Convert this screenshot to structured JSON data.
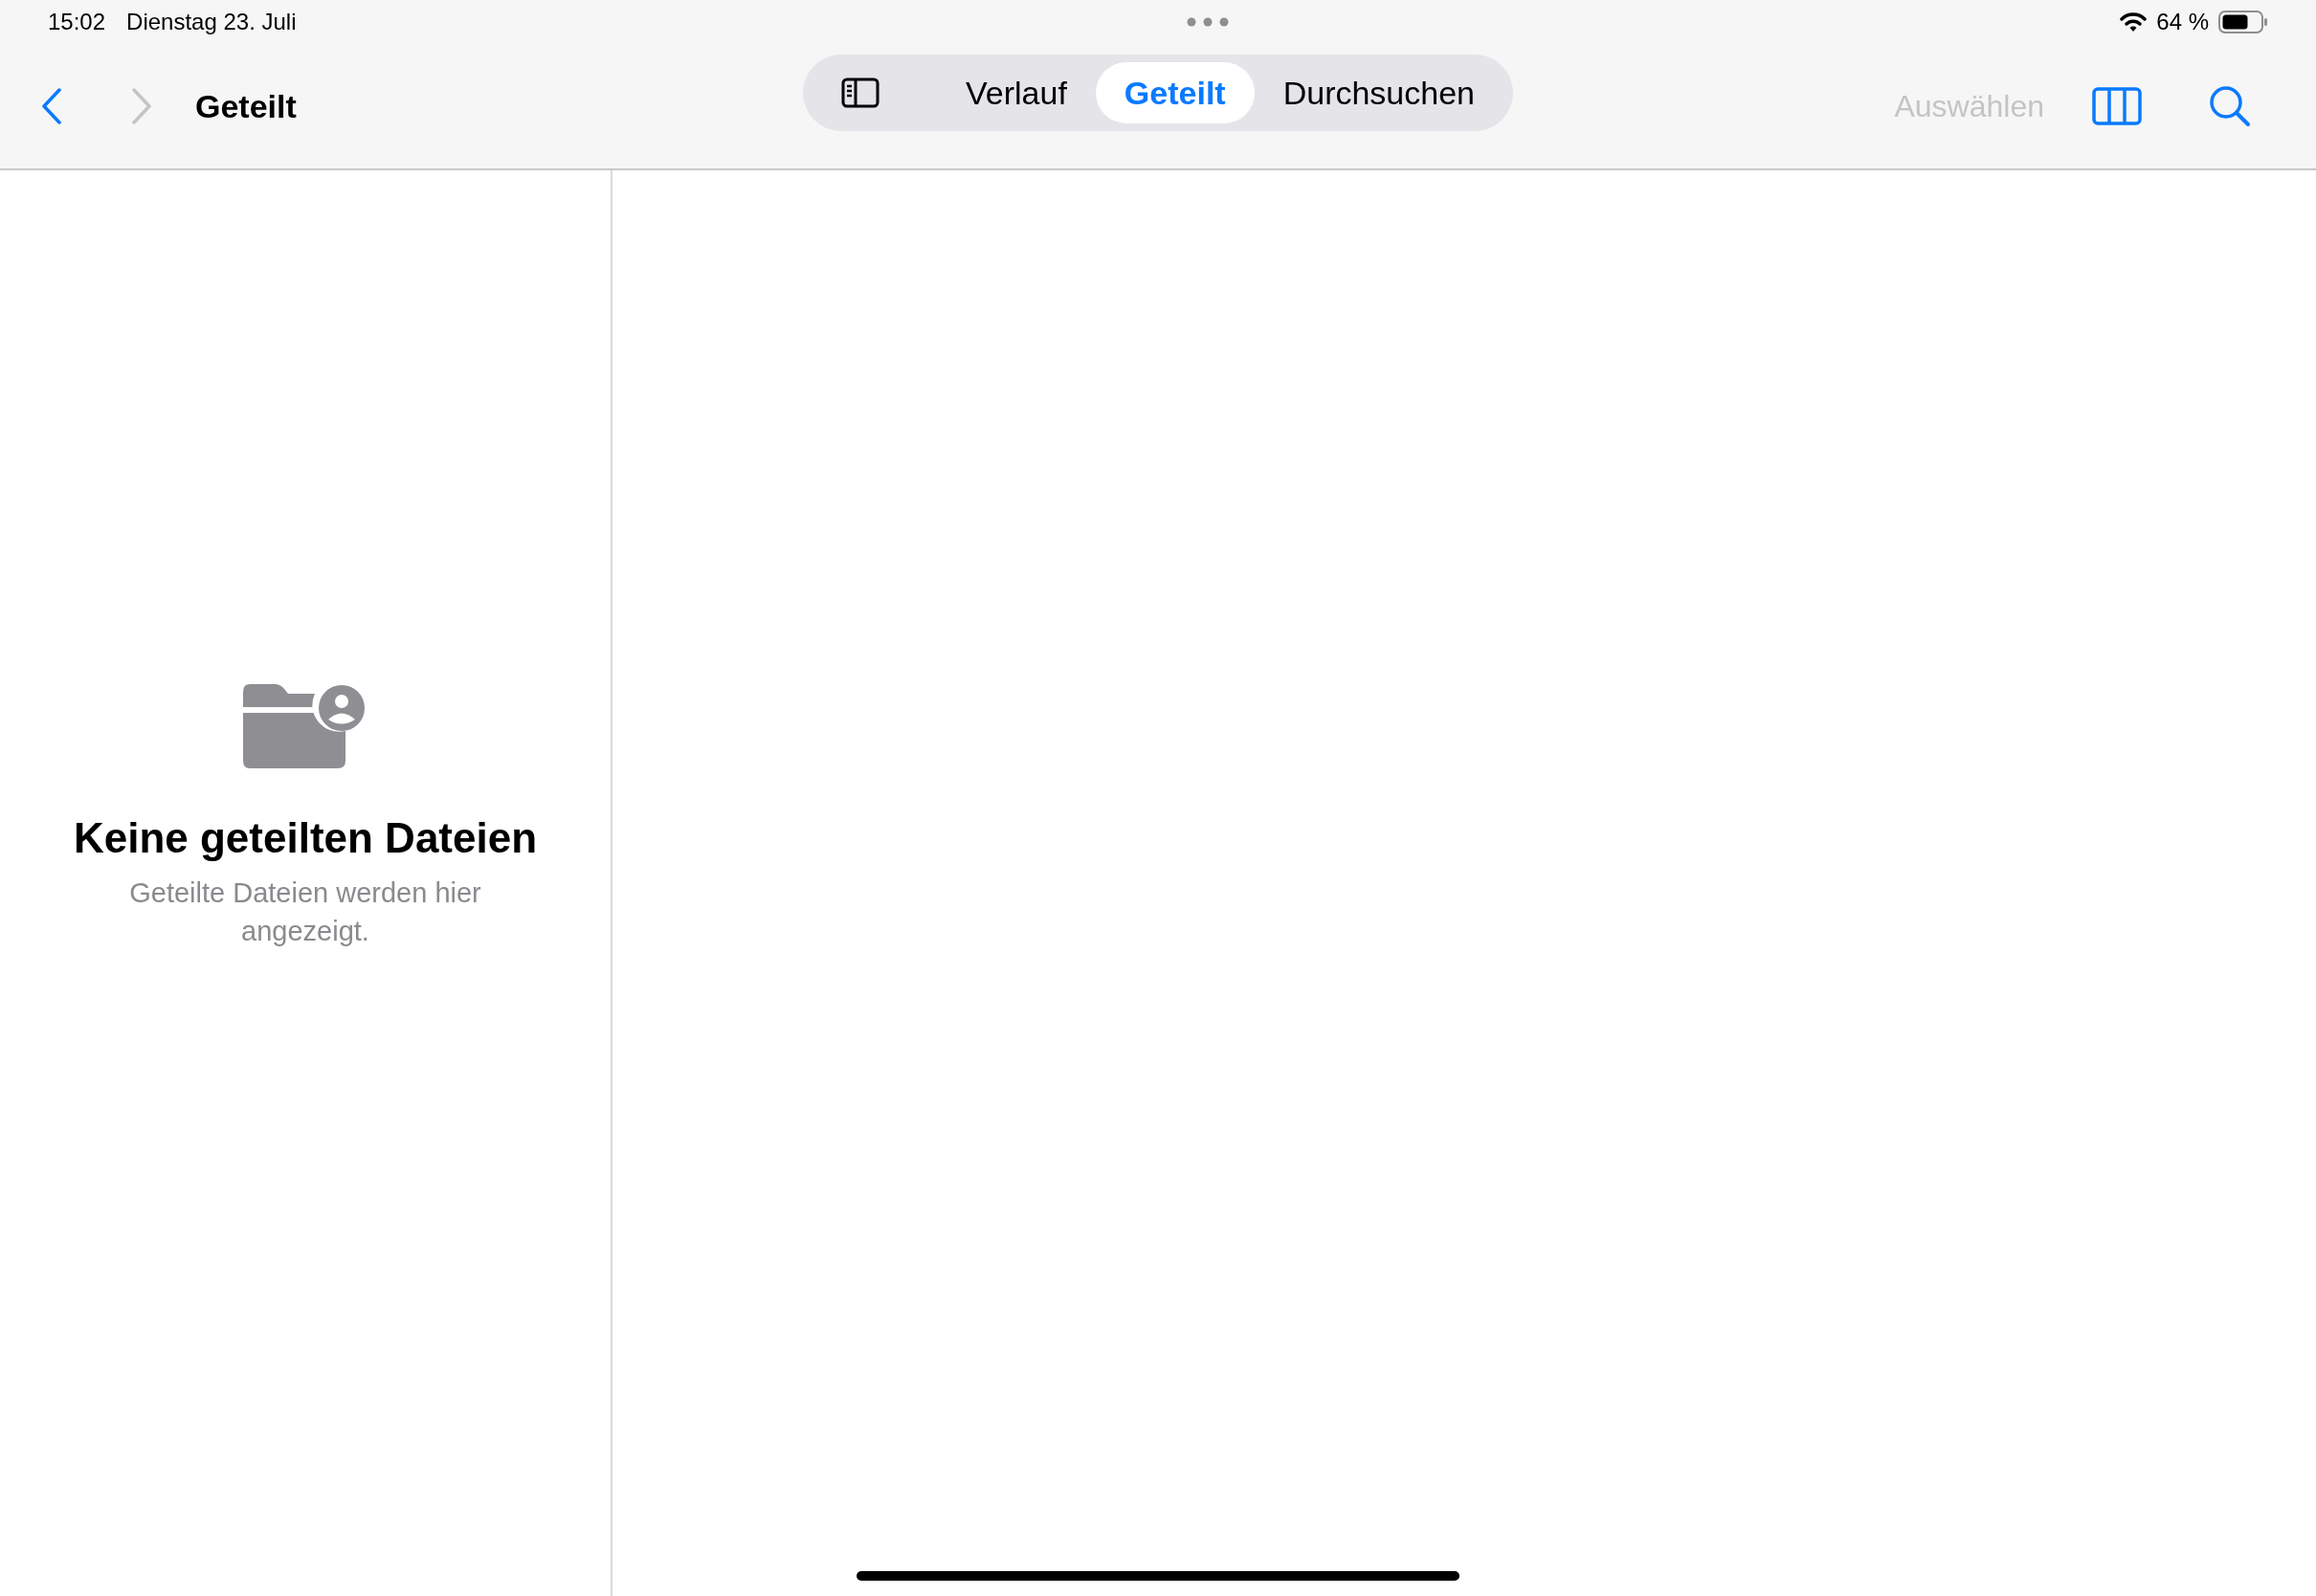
{
  "status_bar": {
    "time": "15:02",
    "date": "Dienstag 23. Juli",
    "battery": "64 %"
  },
  "nav_bar": {
    "back": {
      "disabled": false
    },
    "forward": {
      "disabled": true
    },
    "title": "Geteilt",
    "tabs": [
      {
        "label": "Verlauf",
        "selected": false
      },
      {
        "label": "Geteilt",
        "selected": true
      },
      {
        "label": "Durchsuchen",
        "selected": false
      }
    ],
    "select_button": {
      "label": "Auswählen",
      "disabled": true
    }
  },
  "empty_state": {
    "title": "Keine geteilten Dateien",
    "message": "Geteilte Dateien werden hier angezeigt."
  }
}
